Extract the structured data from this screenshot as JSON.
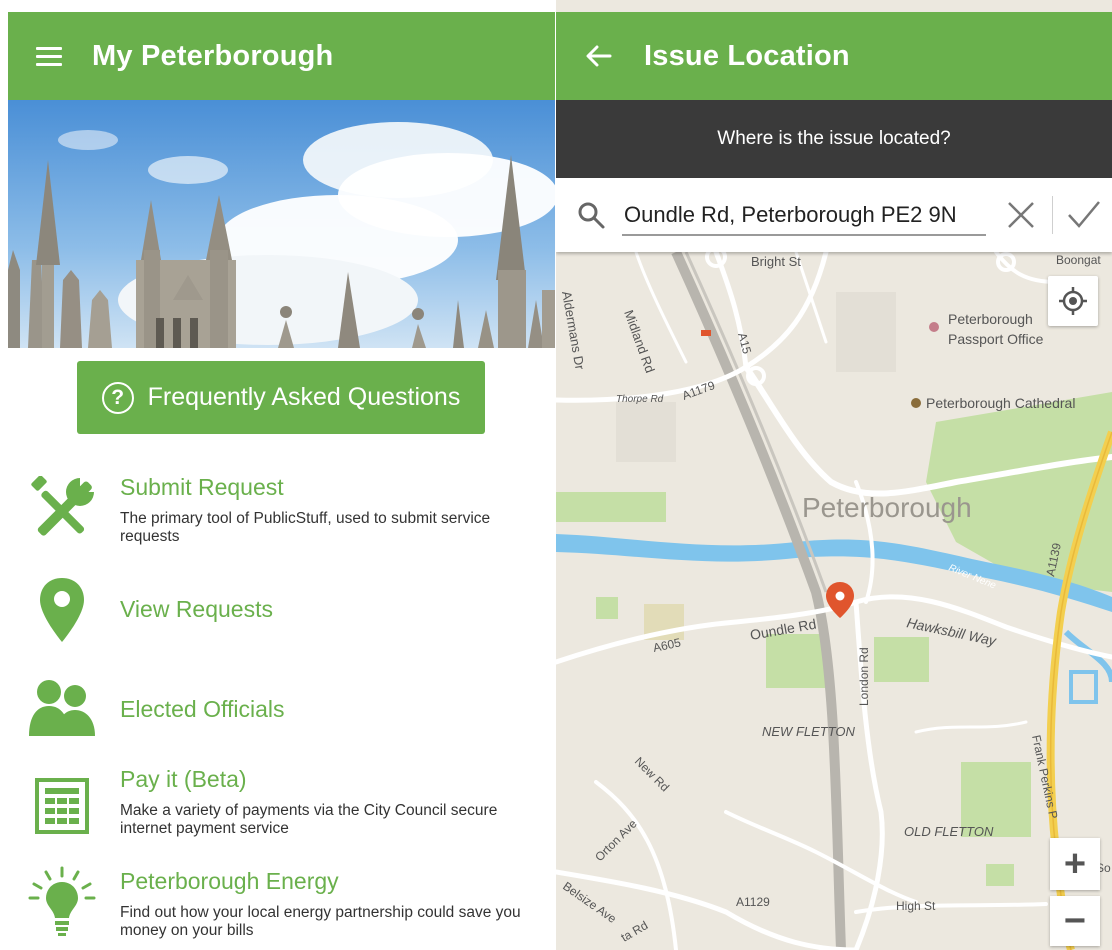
{
  "left_screen": {
    "title": "My Peterborough",
    "faq_label": "Frequently Asked Questions",
    "menu": [
      {
        "title": "Submit Request",
        "description": "The primary tool of PublicStuff, used to submit service requests"
      },
      {
        "title": "View Requests",
        "description": ""
      },
      {
        "title": "Elected Officials",
        "description": ""
      },
      {
        "title": "Pay it (Beta)",
        "description": "Make a variety of payments via the City Council secure internet payment service"
      },
      {
        "title": "Peterborough Energy",
        "description": "Find out how your local energy partnership could save you money on your bills"
      }
    ]
  },
  "right_screen": {
    "title": "Issue Location",
    "prompt": "Where is the issue located?",
    "search_value": "Oundle Rd, Peterborough PE2 9N",
    "map_labels": {
      "city": "Peterborough",
      "bright_st": "Bright St",
      "boongate": "Boongat",
      "aldermans": "Aldermans Dr",
      "midland": "Midland Rd",
      "a15": "A15",
      "thorpe": "Thorpe Rd",
      "a1179": "A1179",
      "passport_1": "Peterborough",
      "passport_2": "Passport Office",
      "cathedral": "Peterborough Cathedral",
      "river": "River Nene",
      "a1139": "A1139",
      "a605": "A605",
      "oundle": "Oundle Rd",
      "london": "London Rd",
      "hawksbill": "Hawksbill Way",
      "new_fletton": "NEW FLETTON",
      "new_rd": "New Rd",
      "orton": "Orton Ave",
      "old_fletton": "OLD FLETTON",
      "frank": "Frank Perkins P",
      "belsize": "Belsize Ave",
      "a1129": "A1129",
      "high_st": "High St",
      "so": "So",
      "ta_rd": "ta Rd"
    }
  },
  "colors": {
    "brand_green": "#6ab04c",
    "dark_bar": "#3a3a3a",
    "map_bg": "#ece8df",
    "river": "#7fc4ec",
    "park": "#c5dfa6",
    "pin": "#e0552d",
    "trunk_road": "#f3cf4f"
  },
  "icons": [
    "menu-icon",
    "back-arrow-icon",
    "help-icon",
    "tools-icon",
    "location-pin-icon",
    "people-icon",
    "bill-icon",
    "lightbulb-icon",
    "search-icon",
    "close-icon",
    "check-icon",
    "my-location-icon"
  ]
}
